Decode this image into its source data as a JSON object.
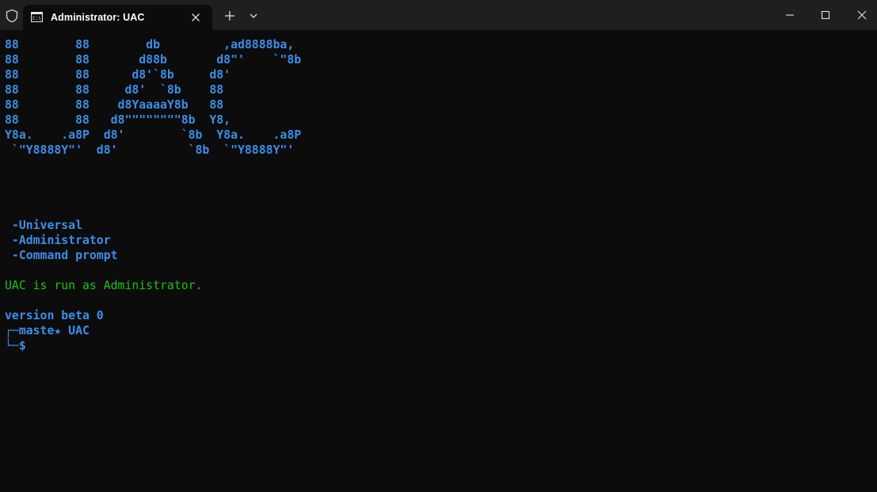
{
  "window": {
    "tab_title": "Administrator:  UAC",
    "colors": {
      "titlebar": "#1f1f1f",
      "terminal_bg": "#0c0c0c",
      "text_blue": "#3b8eea",
      "text_green": "#16c60c"
    },
    "icons": [
      "shield-icon",
      "terminal-tab-icon",
      "close-icon",
      "plus-icon",
      "chevron-down-icon",
      "minimize-icon",
      "maximize-icon",
      "close-window-icon"
    ]
  },
  "terminal": {
    "banner": [
      "88        88        db         ,ad8888ba,",
      "88        88       d88b       d8\"'    `\"8b",
      "88        88      d8'`8b     d8'",
      "88        88     d8'  `8b    88",
      "88        88    d8YaaaaY8b   88",
      "88        88   d8\"\"\"\"\"\"\"\"8b  Y8,",
      "Y8a.    .a8P  d8'        `8b  Y8a.    .a8P",
      " `\"Y8888Y\"'  d8'          `8b  `\"Y8888Y\"'"
    ],
    "menu": [
      " -Universal",
      " -Administrator",
      " -Command prompt"
    ],
    "status": "UAC is run as Administrator.",
    "version": "version beta 0",
    "prompt_top_prefix": "┌─",
    "branch": "maste★ UAC",
    "prompt_bottom_prefix": "└─",
    "prompt_symbol": "$"
  }
}
